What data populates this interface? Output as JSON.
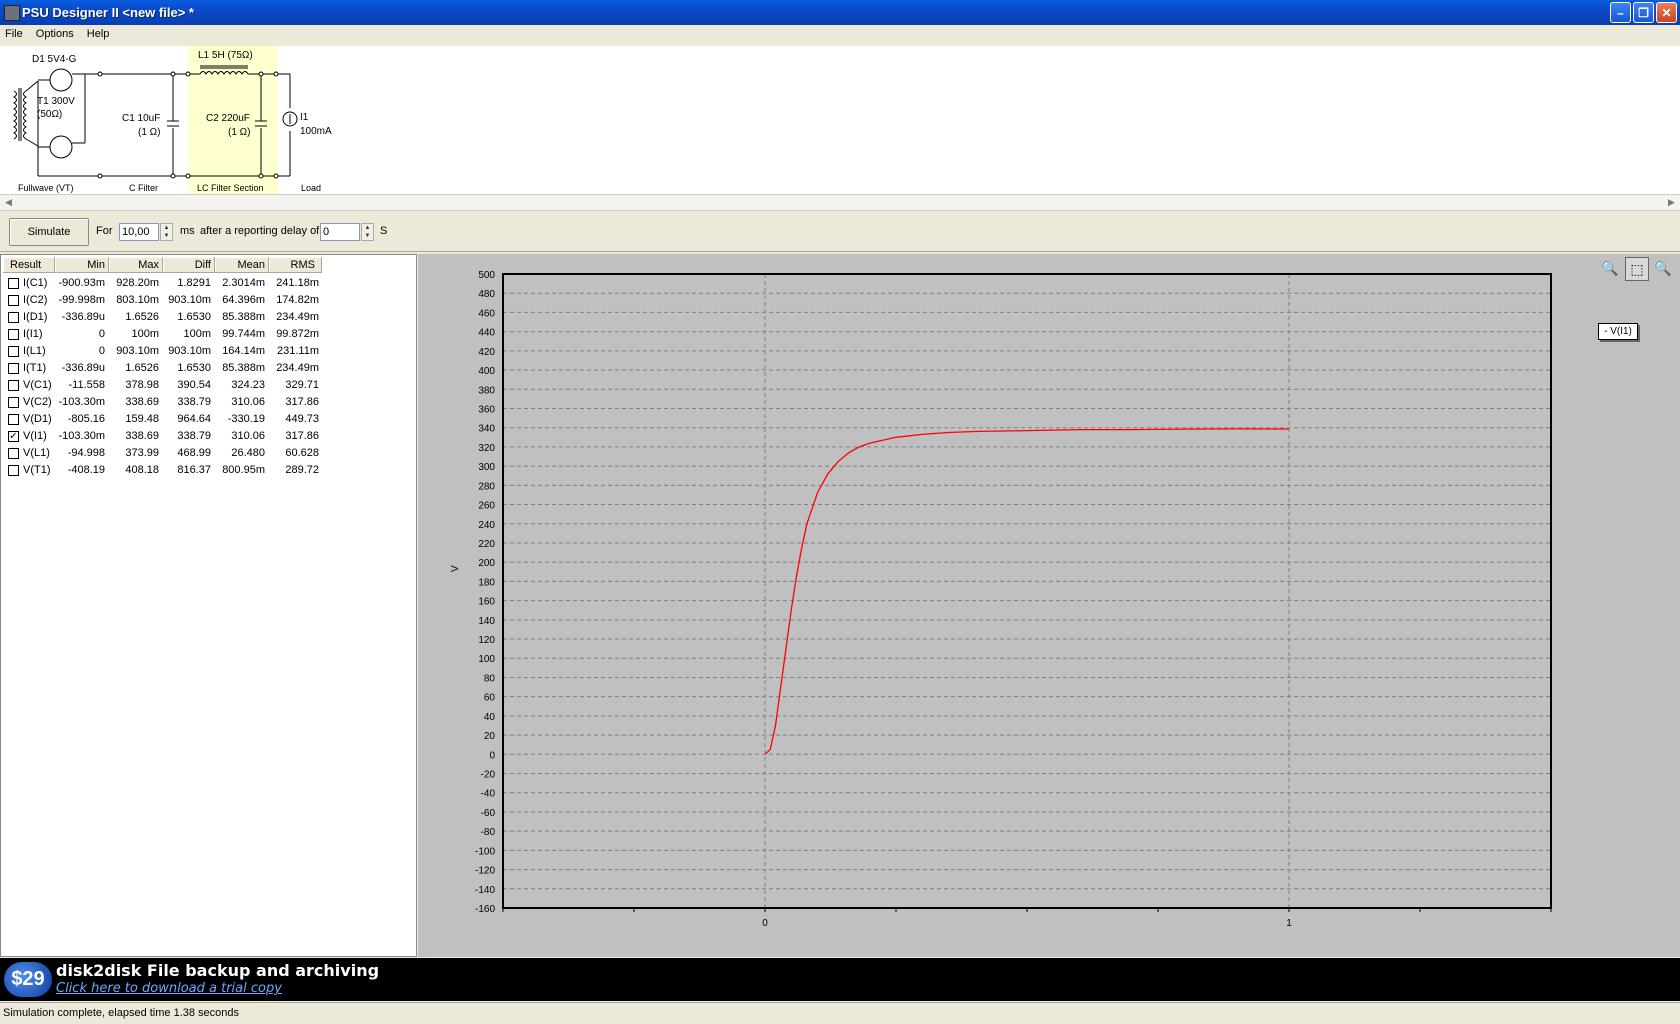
{
  "window": {
    "title": "PSU Designer II  <new file> *",
    "minimize": "–",
    "restore": "❐",
    "close": "✕"
  },
  "menu": [
    "File",
    "Options",
    "Help"
  ],
  "schematic": {
    "d1": "D1 5V4-G",
    "t1_line1": "T1 300V",
    "t1_line2": "(50Ω)",
    "l1": "L1 5H (75Ω)",
    "c1_line1": "C1 10uF",
    "c1_line2": "(1 Ω)",
    "c2_line1": "C2 220uF",
    "c2_line2": "(1 Ω)",
    "i1_line1": "I1",
    "i1_line2": "100mA",
    "sections": [
      "Fullwave (VT)",
      "C Filter",
      "LC Filter Section",
      "Load"
    ]
  },
  "toolbar": {
    "simulate": "Simulate",
    "for_label": "For",
    "for_value": "10,00",
    "ms_label": "ms",
    "delay_label": "after a reporting delay of",
    "delay_value": "0",
    "s_label": "S"
  },
  "results": {
    "headers": [
      "Result",
      "Min",
      "Max",
      "Diff",
      "Mean",
      "RMS"
    ],
    "rows": [
      {
        "name": "I(C1)",
        "checked": false,
        "min": "-900.93m",
        "max": "928.20m",
        "diff": "1.8291",
        "mean": "2.3014m",
        "rms": "241.18m"
      },
      {
        "name": "I(C2)",
        "checked": false,
        "min": "-99.998m",
        "max": "803.10m",
        "diff": "903.10m",
        "mean": "64.396m",
        "rms": "174.82m"
      },
      {
        "name": "I(D1)",
        "checked": false,
        "min": "-336.89u",
        "max": "1.6526",
        "diff": "1.6530",
        "mean": "85.388m",
        "rms": "234.49m"
      },
      {
        "name": "I(I1)",
        "checked": false,
        "min": "0",
        "max": "100m",
        "diff": "100m",
        "mean": "99.744m",
        "rms": "99.872m"
      },
      {
        "name": "I(L1)",
        "checked": false,
        "min": "0",
        "max": "903.10m",
        "diff": "903.10m",
        "mean": "164.14m",
        "rms": "231.11m"
      },
      {
        "name": "I(T1)",
        "checked": false,
        "min": "-336.89u",
        "max": "1.6526",
        "diff": "1.6530",
        "mean": "85.388m",
        "rms": "234.49m"
      },
      {
        "name": "V(C1)",
        "checked": false,
        "min": "-11.558",
        "max": "378.98",
        "diff": "390.54",
        "mean": "324.23",
        "rms": "329.71"
      },
      {
        "name": "V(C2)",
        "checked": false,
        "min": "-103.30m",
        "max": "338.69",
        "diff": "338.79",
        "mean": "310.06",
        "rms": "317.86"
      },
      {
        "name": "V(D1)",
        "checked": false,
        "min": "-805.16",
        "max": "159.48",
        "diff": "964.64",
        "mean": "-330.19",
        "rms": "449.73"
      },
      {
        "name": "V(I1)",
        "checked": true,
        "min": "-103.30m",
        "max": "338.69",
        "diff": "338.79",
        "mean": "310.06",
        "rms": "317.86"
      },
      {
        "name": "V(L1)",
        "checked": false,
        "min": "-94.998",
        "max": "373.99",
        "diff": "468.99",
        "mean": "26.480",
        "rms": "60.628"
      },
      {
        "name": "V(T1)",
        "checked": false,
        "min": "-408.19",
        "max": "408.18",
        "diff": "816.37",
        "mean": "800.95m",
        "rms": "289.72"
      }
    ]
  },
  "chart_data": {
    "type": "line",
    "ylabel": "V",
    "ylim": [
      -160,
      500
    ],
    "y_ticks": [
      500,
      480,
      460,
      440,
      420,
      400,
      380,
      360,
      340,
      320,
      300,
      280,
      260,
      240,
      220,
      200,
      180,
      160,
      140,
      120,
      100,
      80,
      60,
      40,
      20,
      0,
      -20,
      -40,
      -60,
      -80,
      -100,
      -120,
      -140,
      -160
    ],
    "x_tick_labels": [
      "0",
      "1"
    ],
    "xlim": [
      -0.5,
      1.5
    ],
    "grid": true,
    "legend_position": "top-right",
    "series": [
      {
        "name": "V(I1)",
        "color": "#ff0000",
        "x": [
          0,
          0.01,
          0.02,
          0.03,
          0.04,
          0.05,
          0.06,
          0.07,
          0.08,
          0.1,
          0.12,
          0.14,
          0.16,
          0.18,
          0.2,
          0.25,
          0.3,
          0.35,
          0.4,
          0.5,
          0.6,
          0.7,
          0.8,
          0.9,
          1.0
        ],
        "y": [
          0,
          5,
          30,
          70,
          110,
          150,
          185,
          215,
          240,
          272,
          292,
          305,
          314,
          320,
          324,
          330,
          333,
          335,
          336,
          337,
          338,
          338,
          338.5,
          338.7,
          338.69
        ]
      }
    ]
  },
  "banner": {
    "price": "$29",
    "headline": "disk2disk File backup and archiving",
    "link": "Click here to download a trial copy"
  },
  "status": "Simulation complete, elapsed time 1.38 seconds"
}
